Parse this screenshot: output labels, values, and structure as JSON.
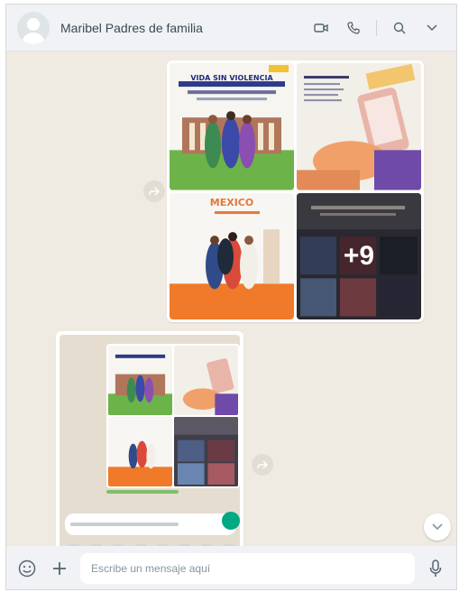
{
  "header": {
    "title": "Maribel Padres de familia"
  },
  "album": {
    "tile1_title": "VIDA SIN VIOLENCIA",
    "tile3_title": "MEXICO",
    "more_count": "+9"
  },
  "footer": {
    "placeholder": "Escribe un mensaje aquí"
  },
  "colors": {
    "accent": "#00a884",
    "wallpaper": "#efeae2",
    "header_bg": "#f0f2f5"
  }
}
